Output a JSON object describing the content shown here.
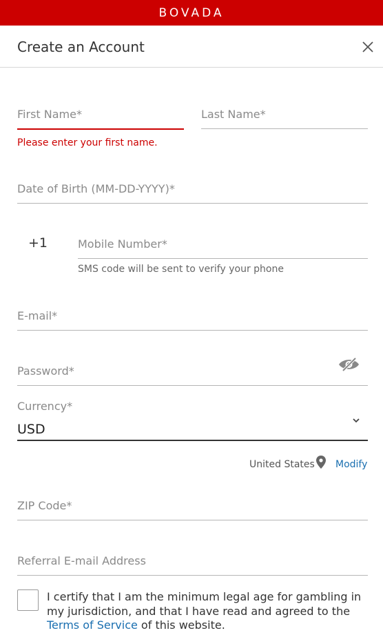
{
  "brand": {
    "logo_text": "BOVADA",
    "color": "#cc0000"
  },
  "header": {
    "title": "Create an Account",
    "close_icon": "close-icon"
  },
  "form": {
    "first_name": {
      "label": "First Name*",
      "value": "",
      "error": "Please enter your first name."
    },
    "last_name": {
      "label": "Last Name*",
      "value": ""
    },
    "dob": {
      "label": "Date of Birth (MM-DD-YYYY)*",
      "value": ""
    },
    "phone": {
      "prefix": "+1",
      "label": "Mobile Number*",
      "value": "",
      "helper": "SMS code will be sent to verify your phone"
    },
    "email": {
      "label": "E-mail*",
      "value": ""
    },
    "password": {
      "label": "Password*",
      "value": "",
      "toggle_icon": "eye-slash-icon"
    },
    "currency": {
      "label": "Currency*",
      "value": "USD",
      "icon": "chevron-down-icon"
    },
    "location": {
      "country": "United States",
      "icon": "map-pin-icon",
      "modify_label": "Modify"
    },
    "zip": {
      "label": "ZIP Code*",
      "value": ""
    },
    "referral": {
      "label": "Referral E-mail Address",
      "value": ""
    },
    "certify": {
      "checked": false,
      "text_before": "I certify that I am the minimum legal age for gambling in my jurisdiction, and that I have read and agreed to the ",
      "link": "Terms of Service",
      "text_after": " of this website."
    }
  },
  "colors": {
    "error": "#cc0000",
    "link": "#1a6fb0"
  }
}
